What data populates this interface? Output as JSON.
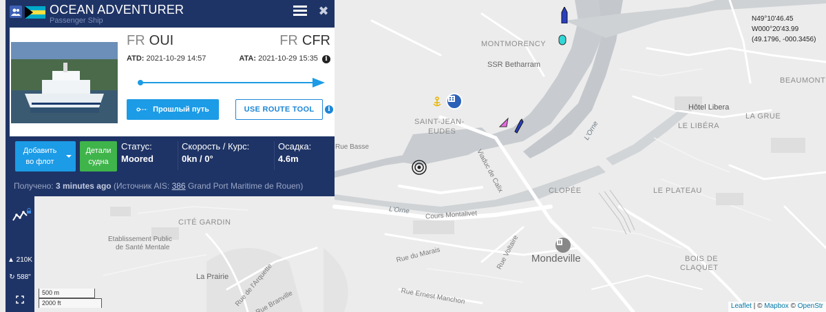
{
  "vessel": {
    "name": "OCEAN ADVENTURER",
    "type": "Passenger Ship",
    "flag": "bahamas-flag-icon"
  },
  "voyage": {
    "from_country": "FR",
    "from_port": "OUI",
    "to_country": "FR",
    "to_port": "CFR",
    "atd_label": "ATD:",
    "atd_value": "2021-10-29 14:57",
    "ata_label": "ATA:",
    "ata_value": "2021-10-29 15:35"
  },
  "buttons": {
    "past_track": "Прошлый путь",
    "route_tool": "USE ROUTE TOOL",
    "add_to_fleet_line1": "Добавить",
    "add_to_fleet_line2": "во флот",
    "details_line1": "Детали",
    "details_line2": "судна"
  },
  "status": {
    "status_label": "Статус:",
    "status_value": "Moored",
    "speed_label": "Скорость / Курс:",
    "speed_value": "0kn / 0°",
    "draught_label": "Осадка:",
    "draught_value": "4.6m"
  },
  "received": {
    "prefix": "Получено:",
    "age": "3 minutes ago",
    "source_prefix": "(Источник AIS:",
    "station_id": "386",
    "station_name": "Grand Port Maritime de Rouen)"
  },
  "toolbar": {
    "vessels_count": "210K",
    "refresh_count": "588\""
  },
  "coords": {
    "lat": "N49°10'46.45",
    "lon": "W000°20'43.99",
    "decimal": "(49.1796, -000.3456)"
  },
  "scale": {
    "metric": "500 m",
    "imperial": "2000 ft"
  },
  "attribution": {
    "leaflet": "Leaflet",
    "sep1": " | © ",
    "mapbox": "Mapbox",
    "sep2": " © ",
    "osm": "OpenStr"
  },
  "map_labels": {
    "montmorency": "MONTMORENCY",
    "ssr": "SSR Betharram",
    "saint_jean_1": "SAINT-JEAN-",
    "saint_jean_2": "EUDES",
    "beaumont": "BEAUMONT",
    "hotel_libera": "Hôtel Libera",
    "la_grue": "LA GRUE",
    "le_libera": "LE LIBÉRA",
    "clopee": "CLOPÉE",
    "le_plateau": "LE PLATEAU",
    "cite_gardin": "CITÉ GARDIN",
    "etab_1": "Etablissement Public",
    "etab_2": "de Santé Mentale",
    "mondeville": "Mondeville",
    "bois_1": "BOIS DE",
    "bois_2": "CLAQUET",
    "la_prairie": "La Prairie",
    "rue_basse": "Rue Basse",
    "viaduc": "Viaduc de Calix",
    "lorne_1": "L'Orne",
    "lorne_2": "L'Orne",
    "cours_montalivet": "Cours Montalivet",
    "rue_voltaire": "Rue Voltaire",
    "rue_du_marais": "Rue du Marais",
    "rue_ernest": "Rue Ernest Manchon",
    "rue_arquette": "Rue de l'Arquette",
    "rue_branville": "Rue Branville"
  },
  "colors": {
    "panel_bg": "#1f3466",
    "accent_blue": "#1c9be6",
    "details_green": "#3fb44a",
    "water": "#c7cbcf"
  }
}
